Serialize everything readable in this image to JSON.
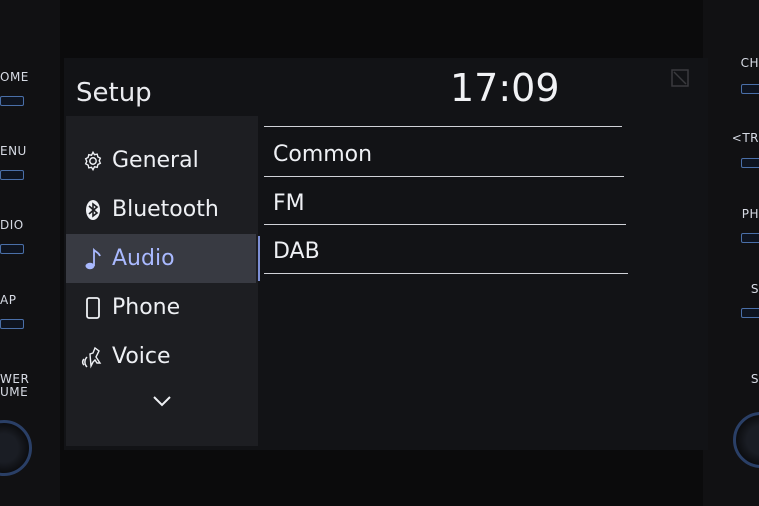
{
  "hardware": {
    "left_labels": [
      "OME",
      "ENU",
      "DIO",
      "AP",
      "WER",
      "UME"
    ],
    "right_labels": [
      "CH",
      "<TR",
      "PH",
      "S",
      "S"
    ]
  },
  "header": {
    "title": "Setup",
    "clock": "17:09"
  },
  "sidebar": {
    "items": [
      {
        "label": "General",
        "icon": "gear-icon"
      },
      {
        "label": "Bluetooth",
        "icon": "bluetooth-icon"
      },
      {
        "label": "Audio",
        "icon": "music-note-icon",
        "active": true
      },
      {
        "label": "Phone",
        "icon": "phone-icon"
      },
      {
        "label": "Voice",
        "icon": "voice-icon"
      }
    ],
    "more": "chevron-down-icon"
  },
  "content": {
    "items": [
      {
        "label": "Common"
      },
      {
        "label": "FM"
      },
      {
        "label": "DAB"
      }
    ]
  },
  "colors": {
    "accent": "#a9b9ff",
    "background": "#121316",
    "sidebar": "#1d1e22",
    "active": "#383a42"
  }
}
